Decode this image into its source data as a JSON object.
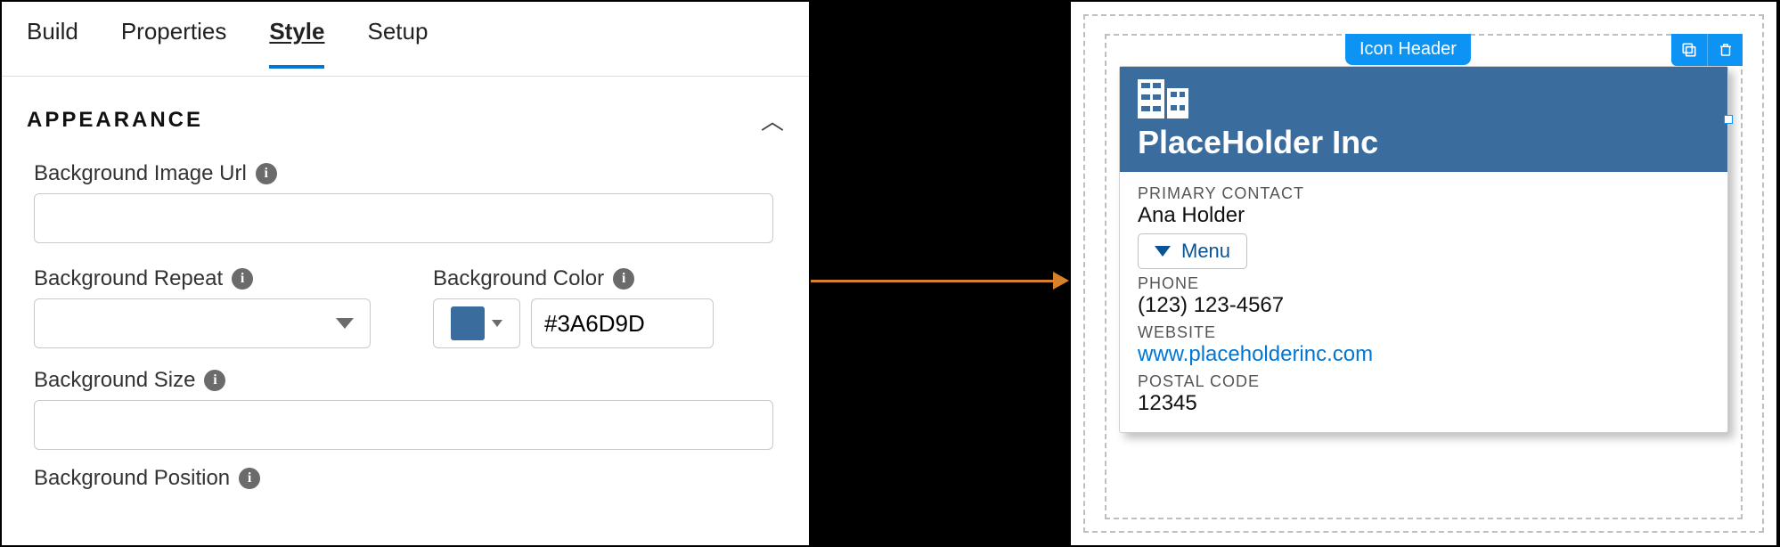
{
  "tabs": {
    "build": "Build",
    "properties": "Properties",
    "style": "Style",
    "setup": "Setup"
  },
  "appearance": {
    "title": "APPEARANCE",
    "bgImageUrl": {
      "label": "Background Image Url",
      "value": ""
    },
    "bgRepeat": {
      "label": "Background Repeat",
      "value": ""
    },
    "bgColor": {
      "label": "Background Color",
      "hex": "#3A6D9D"
    },
    "bgSize": {
      "label": "Background Size",
      "value": ""
    },
    "bgPosition": {
      "label": "Background Position"
    }
  },
  "preview": {
    "badge": "Icon Header",
    "title": "PlaceHolder Inc",
    "primaryContact": {
      "label": "PRIMARY CONTACT",
      "value": "Ana Holder"
    },
    "menuLabel": "Menu",
    "phone": {
      "label": "PHONE",
      "value": "(123) 123-4567"
    },
    "website": {
      "label": "WEBSITE",
      "value": "www.placeholderinc.com"
    },
    "postal": {
      "label": "POSTAL CODE",
      "value": "12345"
    }
  }
}
